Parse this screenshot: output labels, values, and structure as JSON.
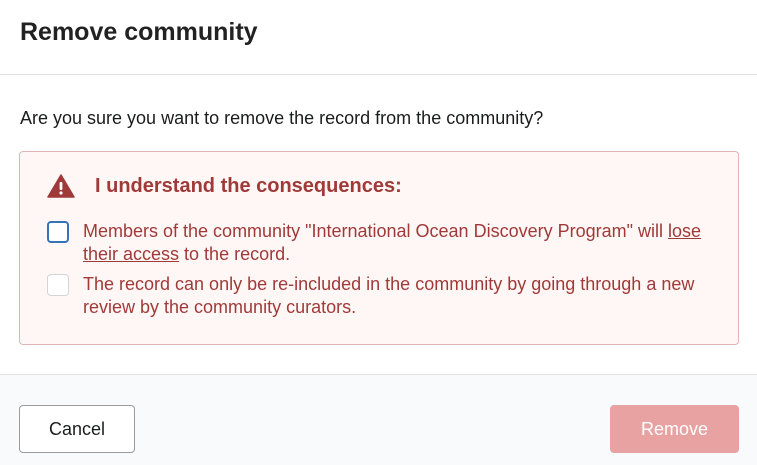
{
  "modal": {
    "title": "Remove community",
    "question": "Are you sure you want to remove the record from the community?"
  },
  "warning": {
    "title": "I understand the consequences:",
    "icon": "warning-triangle-icon",
    "color": "#9f3a38",
    "background": "#fff6f6",
    "items": [
      {
        "text_before": "Members of the community \"International Ocean Discovery Program\" will ",
        "link_text": "lose their access",
        "text_after": " to the record.",
        "checked": false,
        "focused": true
      },
      {
        "text": "The record can only be re-included in the community by going through a new review by the community curators.",
        "checked": false,
        "focused": false
      }
    ]
  },
  "actions": {
    "cancel_label": "Cancel",
    "remove_label": "Remove",
    "remove_color": "#e8a2a2"
  }
}
